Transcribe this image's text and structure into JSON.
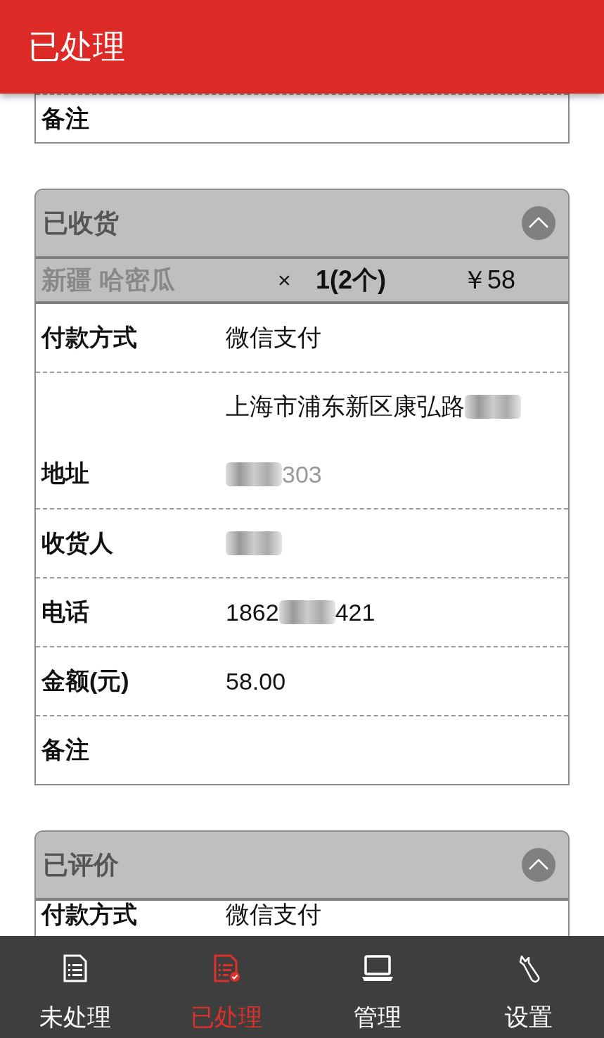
{
  "header": {
    "title": "已处理"
  },
  "orders": [
    {
      "kind": "tail",
      "rows": [
        {
          "label": "备注",
          "lines": []
        }
      ]
    },
    {
      "kind": "card",
      "status": "已收货",
      "expanded": true,
      "product": {
        "name": "新疆 哈密瓜",
        "times": "×",
        "quantity": "1(2个)",
        "price": "￥58"
      },
      "rows": [
        {
          "label": "付款方式",
          "lines": [
            [
              {
                "kind": "text",
                "text": "微信支付"
              }
            ]
          ]
        },
        {
          "label": "地址",
          "lines": [
            [
              {
                "kind": "text",
                "text": "上海市浦东新区康弘路"
              },
              {
                "kind": "blur"
              }
            ],
            [
              {
                "kind": "blur"
              },
              {
                "kind": "faded",
                "text": "303"
              }
            ]
          ]
        },
        {
          "label": "收货人",
          "lines": [
            [
              {
                "kind": "blur"
              }
            ]
          ]
        },
        {
          "label": "电话",
          "lines": [
            [
              {
                "kind": "text",
                "text": "1862"
              },
              {
                "kind": "blur"
              },
              {
                "kind": "text",
                "text": "421"
              }
            ]
          ]
        },
        {
          "label": "金额(元)",
          "lines": [
            [
              {
                "kind": "text",
                "text": "58.00"
              }
            ]
          ]
        },
        {
          "label": "备注",
          "lines": []
        }
      ]
    },
    {
      "kind": "card",
      "status": "已评价",
      "expanded": true,
      "rows": [
        {
          "label": "付款方式",
          "lines": [
            [
              {
                "kind": "text",
                "text": "微信支付"
              }
            ]
          ]
        }
      ]
    }
  ],
  "nav": [
    {
      "label": "未处理",
      "selected": false
    },
    {
      "label": "已处理",
      "selected": true
    },
    {
      "label": "管理",
      "selected": false
    },
    {
      "label": "设置",
      "selected": false
    }
  ]
}
